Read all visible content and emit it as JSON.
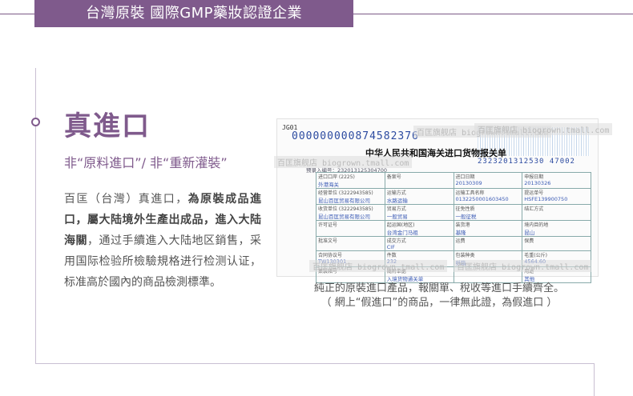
{
  "header": {
    "title": "台灣原裝 國際GMP藥妝認證企業"
  },
  "section": {
    "title": "真進口",
    "subtitle": "非“原料進口”/ 非“重新灌裝”"
  },
  "description": {
    "part1": "百匡（台灣）真進口，",
    "bold1": "為原裝成品進口，屬大陆境外生產出成品，進入大陆海關",
    "part2": "，通过手續進入大陆地区銷售，采用国际检验所檢驗規格进行检测认证，标准高於國內的商品檢測標準。"
  },
  "document": {
    "code": "JG01",
    "number": "000000000874582376",
    "title": "中华人民共和国海关进口货物报关单",
    "pre_entry": "预录入编号：232013125304700",
    "sequence": "2323201312530 47002",
    "cells": [
      [
        "进口口岸 (2225)",
        "外港海关",
        "备案号",
        "",
        "进口日期",
        "20130309",
        "申报日期",
        "20130326"
      ],
      [
        "经营单位 (3222943585)",
        "昆山百匡贸易有限公司",
        "运输方式",
        "水路运输",
        "运输工具名称",
        "0132250001603450",
        "提运单号",
        "HSFE139900750"
      ],
      [
        "收货单位 (3222943585)",
        "昆山百匡贸易有限公司",
        "贸易方式",
        "一般贸易",
        "征免性质",
        "一般征税",
        "结汇方式",
        ""
      ],
      [
        "许可证号",
        "",
        "起运国(地区)",
        "台湾金门马祖",
        "装货港",
        "基隆",
        "境内目的地",
        "昆山"
      ],
      [
        "批准文号",
        "",
        "成交方式",
        "CIF",
        "运费",
        "",
        "保费",
        ""
      ],
      [
        "合同协议号",
        "TW130301",
        "件数",
        "232",
        "包装种类",
        "纸箱",
        "毛重(公斤)",
        "4564.60"
      ],
      [
        "集装箱号",
        "",
        "随附单据",
        "入境货物通关单",
        "",
        "",
        "用途",
        "其他"
      ]
    ]
  },
  "watermarks": [
    "百匡旗舰店 biogrown.tmall.com",
    "百匡旗舰店 biogrown.tmall.com",
    "百匡旗舰店 biogrown.tmall.com",
    "百匡旗舰店 biogrown.tmall.com",
    "百匡旗舰店 biogrown.tmall.com"
  ],
  "caption": {
    "line1": "純正的原裝進口產品，報關單、稅收等進口手續齊全。",
    "line2": "（ 網上“假進口”的商品，一律無此證，為假進口 ）"
  },
  "colors": {
    "brand": "#7f5a8c",
    "text": "#555555",
    "line": "#c9bfd2"
  }
}
